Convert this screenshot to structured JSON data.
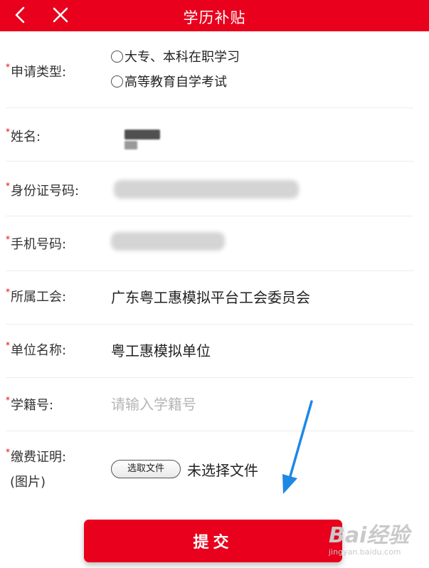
{
  "header": {
    "title": "学历补贴"
  },
  "form": {
    "required_mark": "*",
    "apply_type": {
      "label": "申请类型:",
      "options": [
        "大专、本科在职学习",
        "高等教育自学考试"
      ]
    },
    "name": {
      "label": "姓名:"
    },
    "id_number": {
      "label": "身份证号码:"
    },
    "phone": {
      "label": "手机号码:"
    },
    "union": {
      "label": "所属工会:",
      "value": "广东粤工惠模拟平台工会委员会"
    },
    "company": {
      "label": "单位名称:",
      "value": "粤工惠模拟单位"
    },
    "student_id": {
      "label": "学籍号:",
      "placeholder": "请输入学籍号"
    },
    "payment_proof": {
      "label": "缴费证明:",
      "sublabel": "(图片)",
      "button_label": "选取文件",
      "status": "未选择文件"
    }
  },
  "submit_label": "提交",
  "watermark": {
    "brand": "Bai经验",
    "url": "jingyan.baidu.com"
  },
  "colors": {
    "accent": "#e8001c",
    "arrow": "#1e88e5"
  },
  "icons": {
    "back": "chevron-left-icon",
    "close": "close-icon",
    "arrow": "arrow-down-icon"
  }
}
